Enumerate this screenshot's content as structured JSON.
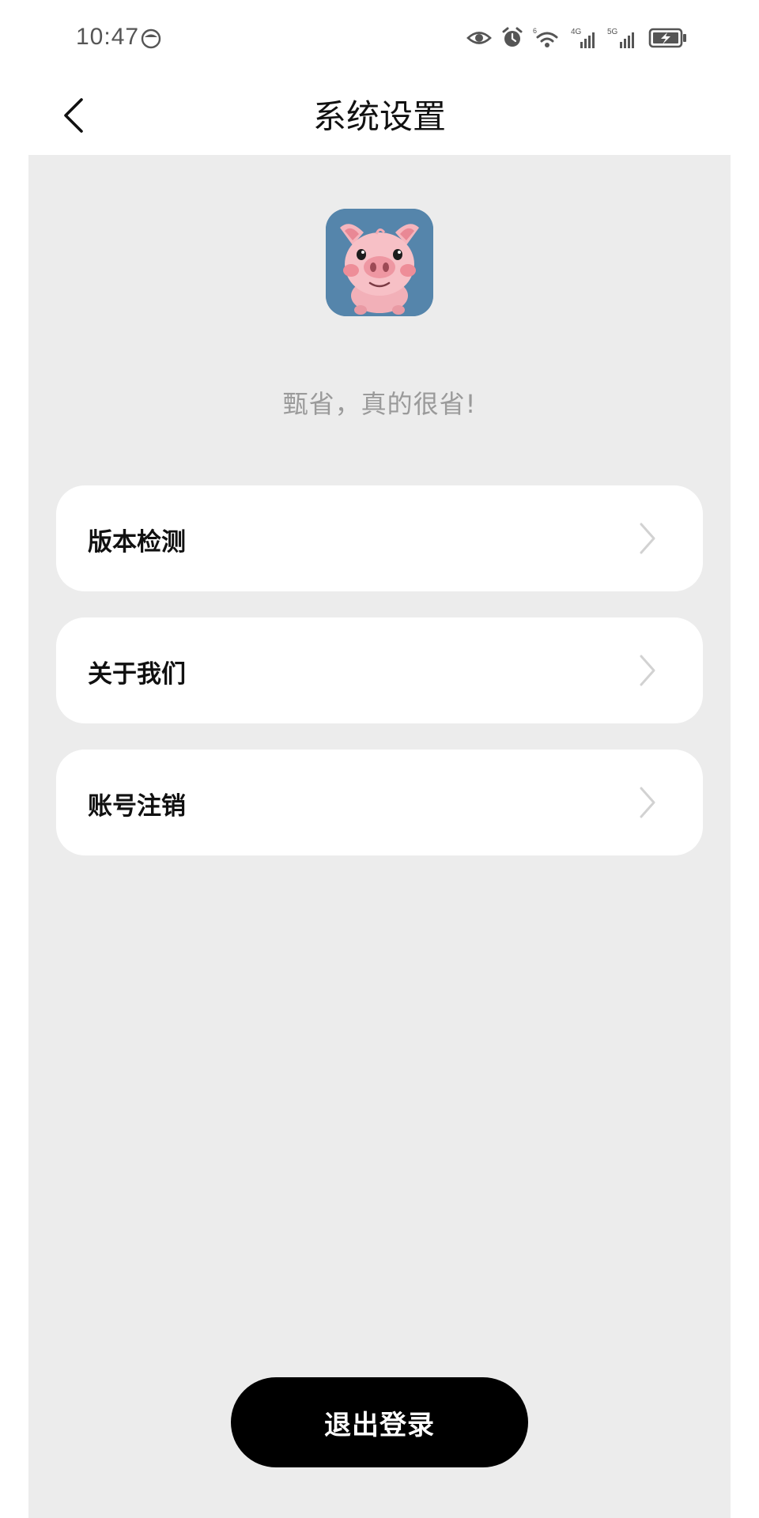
{
  "status_bar": {
    "time": "10:47",
    "wifi_label": "6",
    "network_4g": "4G",
    "network_5g": "5G",
    "icons": [
      "eye-icon",
      "alarm-icon",
      "wifi-icon",
      "signal-4g-icon",
      "signal-5g-icon",
      "battery-charging-icon"
    ]
  },
  "header": {
    "title": "系统设置",
    "back_icon": "chevron-left-icon"
  },
  "app": {
    "logo": "piggy-logo",
    "slogan": "甄省，真的很省!"
  },
  "menu": {
    "items": [
      {
        "label": "版本检测",
        "icon": "chevron-right-icon"
      },
      {
        "label": "关于我们",
        "icon": "chevron-right-icon"
      },
      {
        "label": "账号注销",
        "icon": "chevron-right-icon"
      }
    ]
  },
  "logout": {
    "label": "退出登录"
  },
  "colors": {
    "background": "#ececec",
    "card": "#ffffff",
    "primary_button": "#000000",
    "slogan_text": "#9a9a9a"
  }
}
